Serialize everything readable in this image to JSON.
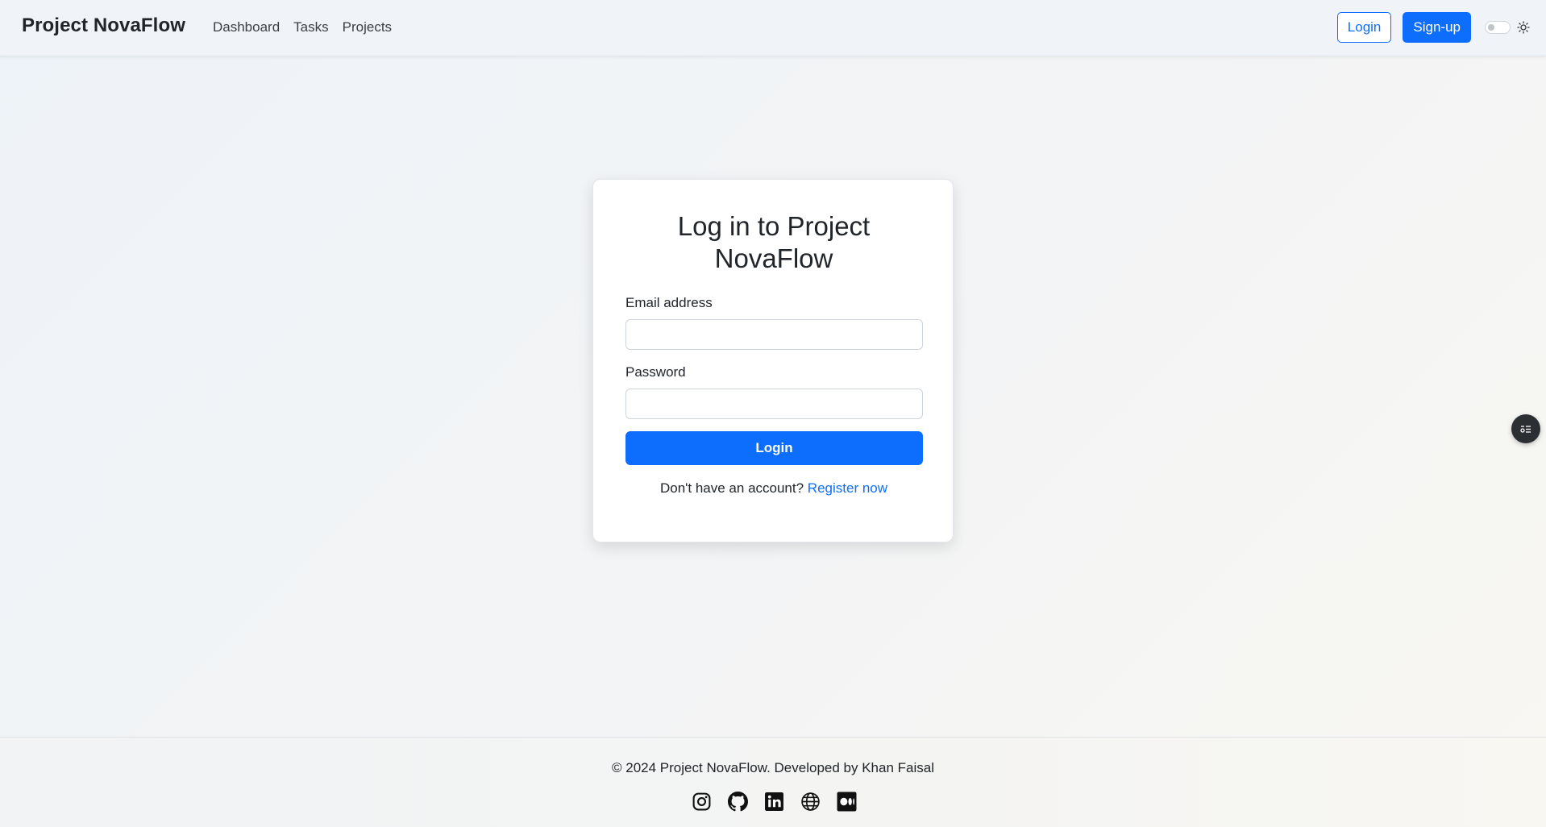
{
  "navbar": {
    "brand": "Project NovaFlow",
    "links": [
      {
        "label": "Dashboard"
      },
      {
        "label": "Tasks"
      },
      {
        "label": "Projects"
      }
    ],
    "login_label": "Login",
    "signup_label": "Sign-up",
    "theme_toggle_on": false,
    "theme_icon": "sun-icon"
  },
  "login_card": {
    "title_line1": "Log in to Project",
    "title_line2": "NovaFlow",
    "email_label": "Email address",
    "email_value": "",
    "password_label": "Password",
    "password_value": "",
    "submit_label": "Login",
    "register_prompt": "Don't have an account?",
    "register_link": "Register now"
  },
  "floating_button": {
    "icon": "toc-list-icon"
  },
  "footer": {
    "copyright": "© 2024 Project NovaFlow. Developed by Khan Faisal",
    "socials": [
      {
        "name": "instagram-icon"
      },
      {
        "name": "github-icon"
      },
      {
        "name": "linkedin-icon"
      },
      {
        "name": "globe-icon"
      },
      {
        "name": "medium-icon"
      }
    ]
  },
  "colors": {
    "accent": "#0d6efd",
    "text": "#212529",
    "navbar_bg": "#f0f4f9"
  }
}
